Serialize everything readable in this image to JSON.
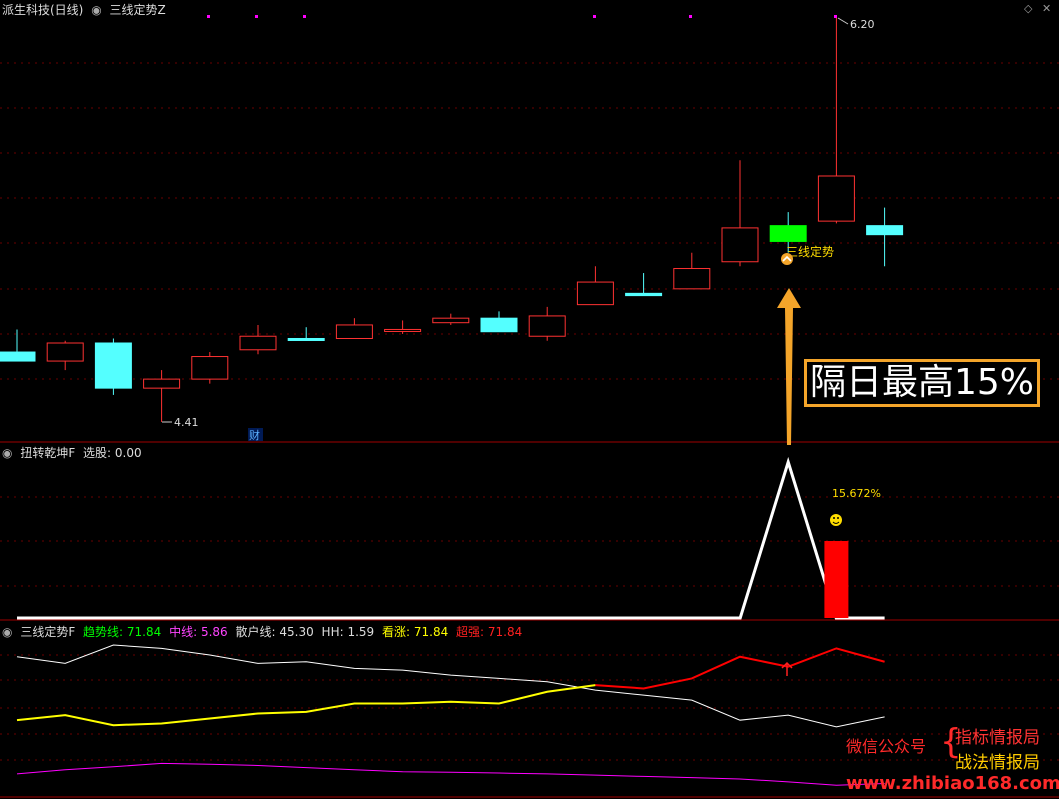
{
  "panel1": {
    "title": "派生科技(日线)",
    "indicator": "三线定势Z",
    "high_label": "6.20",
    "low_label": "4.41",
    "cai_label": "财",
    "signal_label": "三线定势"
  },
  "panel2": {
    "title": "扭转乾坤F",
    "select_label": "选股: 0.00",
    "pct_label": "15.672%"
  },
  "panel3": {
    "title": "三线定势F",
    "trend_label": "趋势线: 71.84",
    "mid_label": "中线: 5.86",
    "retail_label": "散户线: 45.30",
    "hh_label": "HH: 1.59",
    "kanzhang_label": "看涨: 71.84",
    "chaoqiang_label": "超强: 71.84"
  },
  "callout": {
    "text": "隔日最高15%"
  },
  "watermark": {
    "wechat": "微信公众号",
    "brace": "{",
    "name1": "指标情报局",
    "name2": "战法情报局",
    "url": "www.zhibiao168.com"
  },
  "colors": {
    "up": "#ff3232",
    "down": "#54ffff",
    "signal_green": "#00ff00",
    "trend": "#ffff00",
    "mid": "#ff00ff",
    "retail": "#ffffff",
    "strong": "#ff0000",
    "callout": "#f4a52a"
  },
  "chart_data": [
    {
      "type": "candlestick",
      "title": "派生科技(日线)",
      "candles": [
        {
          "o": 4.72,
          "h": 4.82,
          "l": 4.68,
          "c": 4.68,
          "dir": "down"
        },
        {
          "o": 4.68,
          "h": 4.77,
          "l": 4.64,
          "c": 4.76,
          "dir": "up"
        },
        {
          "o": 4.76,
          "h": 4.78,
          "l": 4.53,
          "c": 4.56,
          "dir": "down"
        },
        {
          "o": 4.56,
          "h": 4.64,
          "l": 4.41,
          "c": 4.6,
          "dir": "up"
        },
        {
          "o": 4.6,
          "h": 4.72,
          "l": 4.58,
          "c": 4.7,
          "dir": "up"
        },
        {
          "o": 4.73,
          "h": 4.84,
          "l": 4.71,
          "c": 4.79,
          "dir": "up"
        },
        {
          "o": 4.78,
          "h": 4.83,
          "l": 4.77,
          "c": 4.78,
          "dir": "down"
        },
        {
          "o": 4.78,
          "h": 4.87,
          "l": 4.78,
          "c": 4.84,
          "dir": "up"
        },
        {
          "o": 4.82,
          "h": 4.86,
          "l": 4.8,
          "c": 4.82,
          "dir": "up"
        },
        {
          "o": 4.85,
          "h": 4.89,
          "l": 4.84,
          "c": 4.87,
          "dir": "up"
        },
        {
          "o": 4.87,
          "h": 4.9,
          "l": 4.81,
          "c": 4.81,
          "dir": "down"
        },
        {
          "o": 4.79,
          "h": 4.92,
          "l": 4.77,
          "c": 4.88,
          "dir": "up"
        },
        {
          "o": 4.93,
          "h": 5.1,
          "l": 4.93,
          "c": 5.03,
          "dir": "up"
        },
        {
          "o": 4.98,
          "h": 5.07,
          "l": 4.97,
          "c": 4.97,
          "dir": "down"
        },
        {
          "o": 5.0,
          "h": 5.16,
          "l": 5.0,
          "c": 5.09,
          "dir": "up"
        },
        {
          "o": 5.12,
          "h": 5.57,
          "l": 5.1,
          "c": 5.27,
          "dir": "up"
        },
        {
          "o": 5.28,
          "h": 5.34,
          "l": 5.16,
          "c": 5.21,
          "dir": "signal"
        },
        {
          "o": 5.3,
          "h": 6.2,
          "l": 5.29,
          "c": 5.5,
          "dir": "up"
        },
        {
          "o": 5.28,
          "h": 5.36,
          "l": 5.1,
          "c": 5.24,
          "dir": "down"
        }
      ],
      "ylim": [
        4.35,
        6.25
      ]
    },
    {
      "type": "line",
      "title": "扭转乾坤F",
      "series": [
        {
          "values": [
            0,
            0,
            0,
            0,
            0,
            0,
            0,
            0,
            0,
            0,
            0,
            0,
            0,
            0,
            0,
            0,
            1,
            0,
            0
          ]
        }
      ],
      "bar": {
        "index": 17,
        "value": 15.672
      }
    },
    {
      "type": "line",
      "title": "三线定势F",
      "series": [
        {
          "name": "散户线",
          "values": [
            84,
            80,
            91,
            89,
            85,
            80,
            81,
            77,
            76,
            73,
            71,
            69,
            64,
            61,
            58,
            46,
            49,
            42,
            48
          ]
        },
        {
          "name": "趋势线",
          "values": [
            46,
            49,
            43,
            44,
            47,
            50,
            51,
            56,
            56,
            57,
            56,
            63,
            67,
            65,
            71,
            84,
            78,
            89,
            81
          ]
        },
        {
          "name": "中线",
          "values": [
            5.5,
            6.5,
            7.2,
            8.0,
            7.8,
            7.5,
            7.0,
            6.5,
            6.0,
            5.9,
            5.7,
            5.5,
            5.2,
            4.9,
            4.6,
            4.3,
            3.6,
            2.8,
            3.2
          ]
        }
      ]
    }
  ]
}
